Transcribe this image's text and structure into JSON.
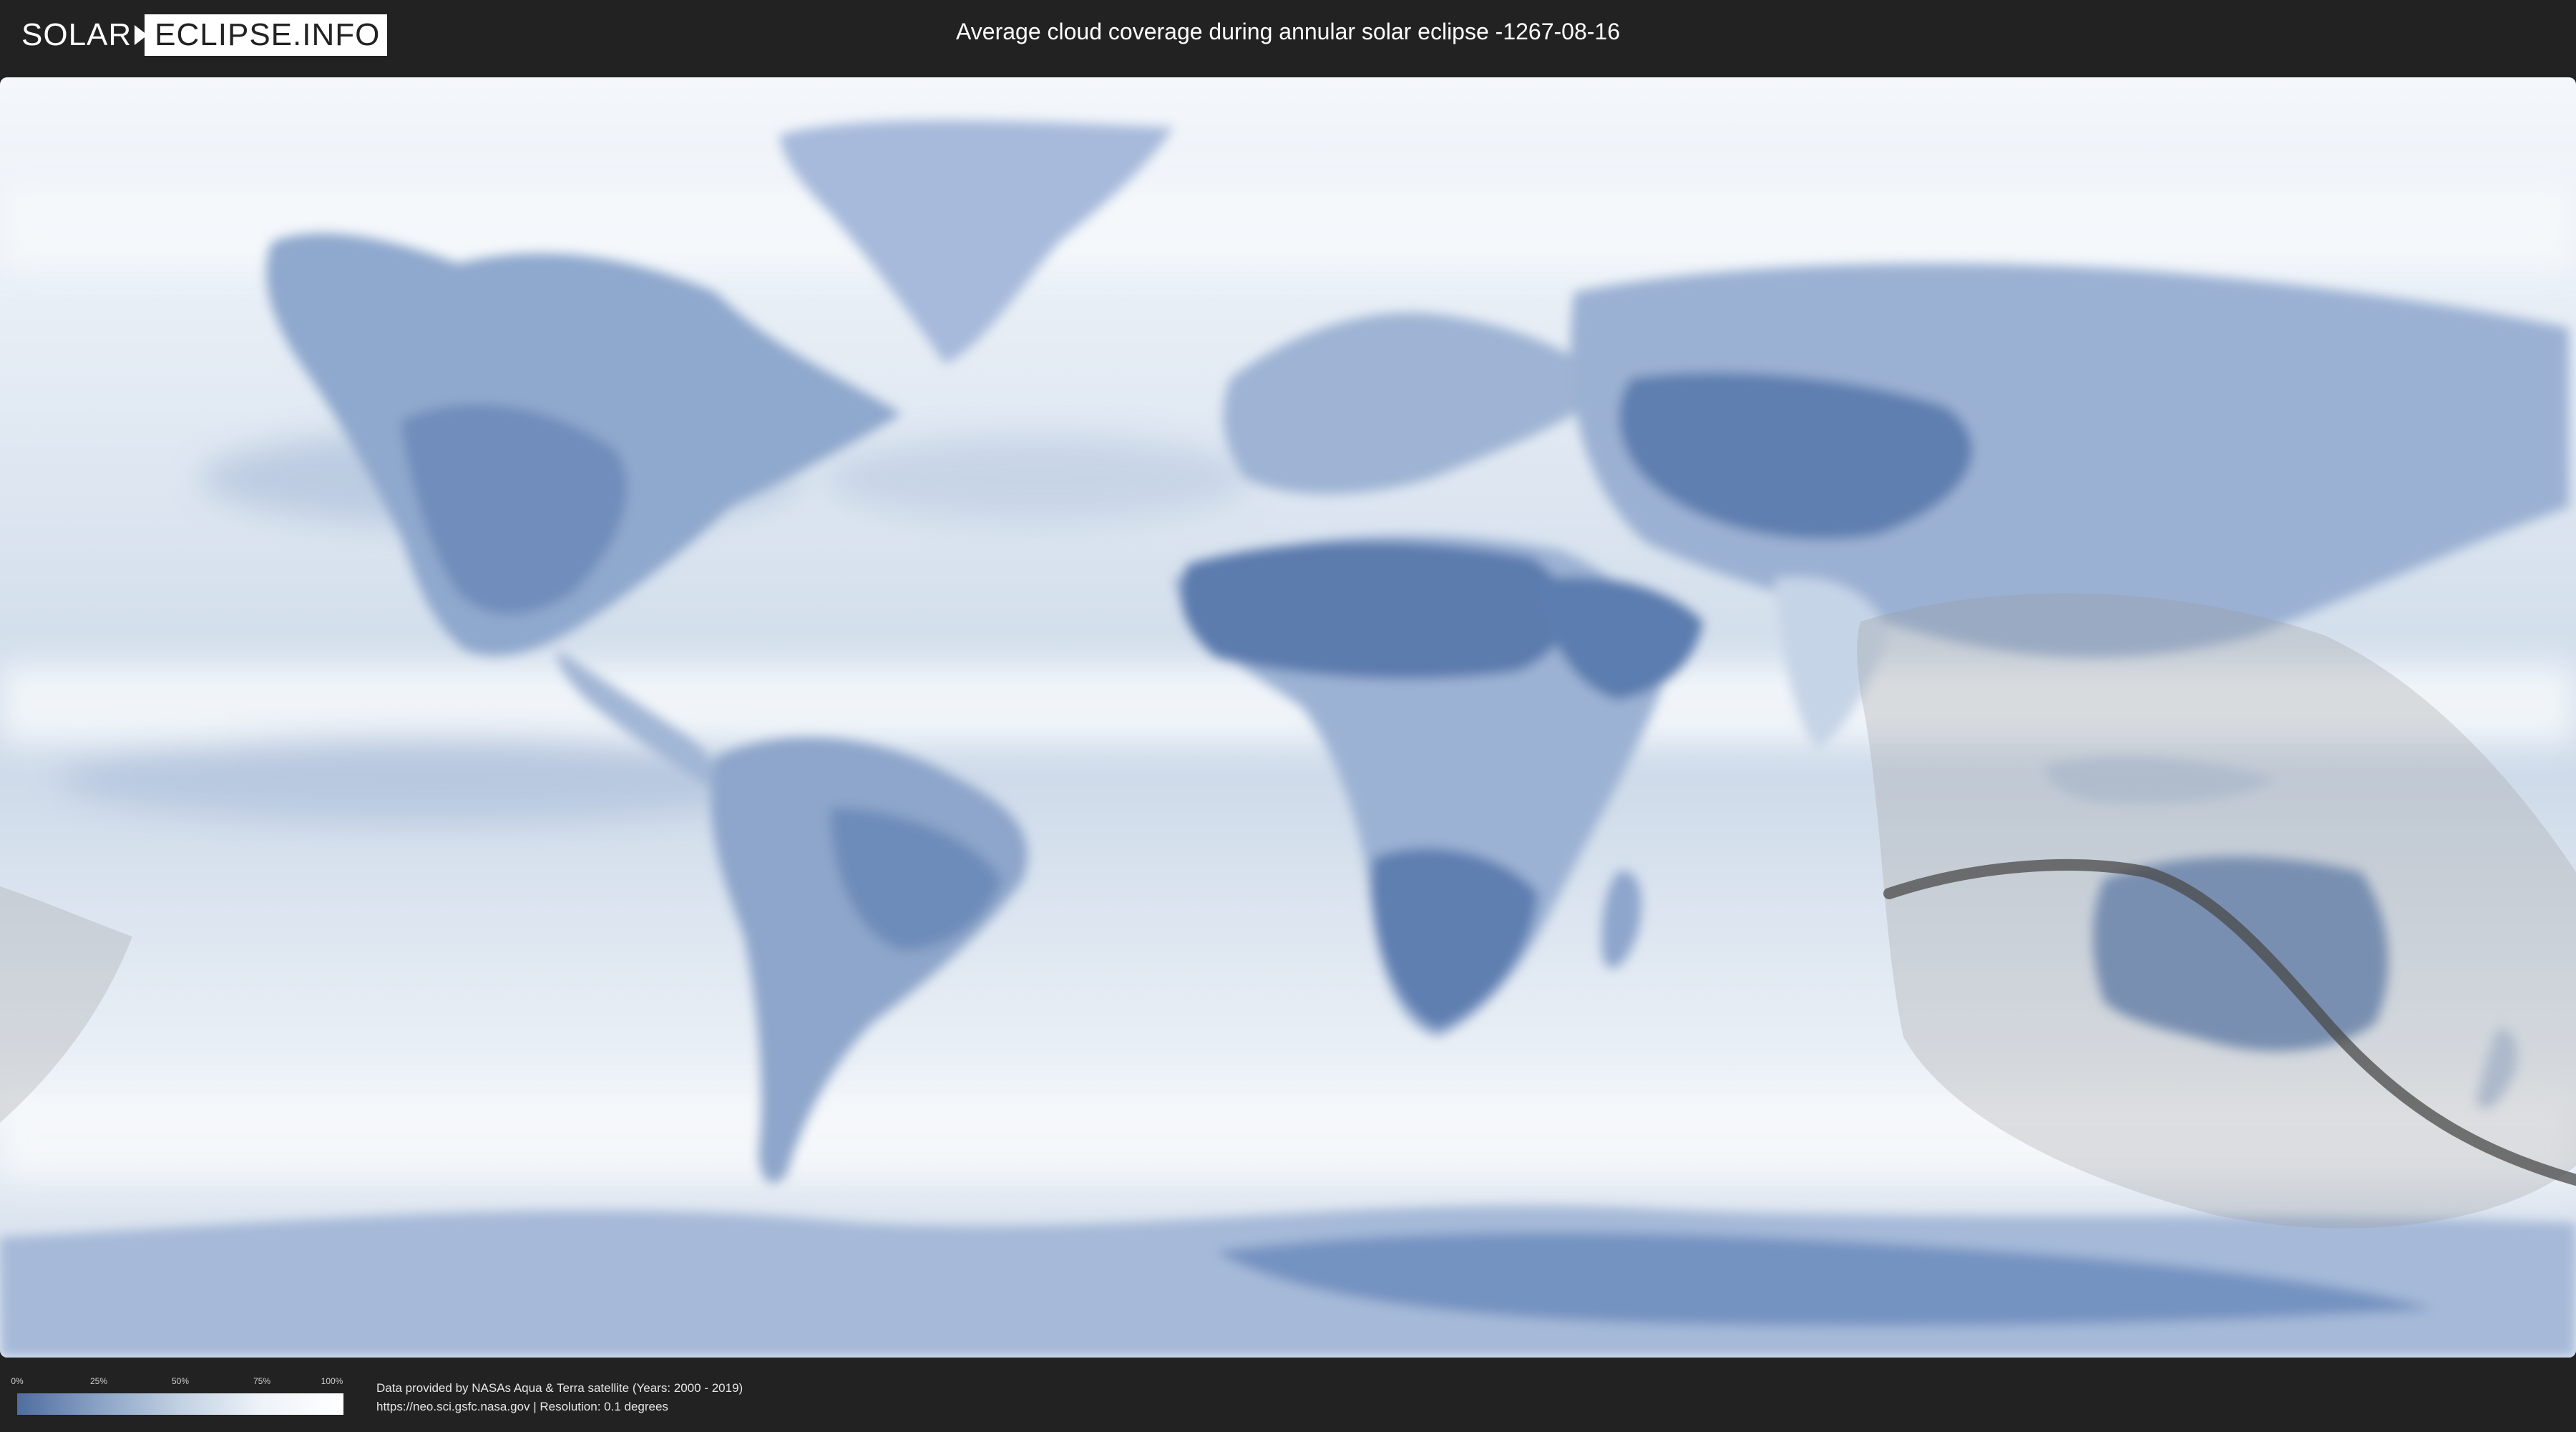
{
  "header": {
    "logo": {
      "part1": "SOLAR",
      "part2": "ECLIPSE.INFO"
    },
    "title": "Average cloud coverage during annular solar eclipse -1267-08-16"
  },
  "legend": {
    "ticks": [
      {
        "label": "0%",
        "value": 0
      },
      {
        "label": "25%",
        "value": 25
      },
      {
        "label": "50%",
        "value": 50
      },
      {
        "label": "75%",
        "value": 75
      },
      {
        "label": "100%",
        "value": 100
      }
    ],
    "gradient_colors": [
      "#4f6d9e",
      "#8aa3c6",
      "#c2d1e3",
      "#eef3f8",
      "#ffffff"
    ]
  },
  "credits": {
    "line1": "Data provided by NASAs Aqua & Terra satellite (Years: 2000 - 2019)",
    "line2": "https://neo.sci.gsfc.nasa.gov | Resolution: 0.1 degrees"
  },
  "map": {
    "ocean_color": "#e9eff6",
    "land_clear_color": "#5e7fb0",
    "land_mid_color": "#a9bcd8",
    "eclipse_zone_color": "#9a9a9a",
    "path_color": "#4a4a4a"
  }
}
